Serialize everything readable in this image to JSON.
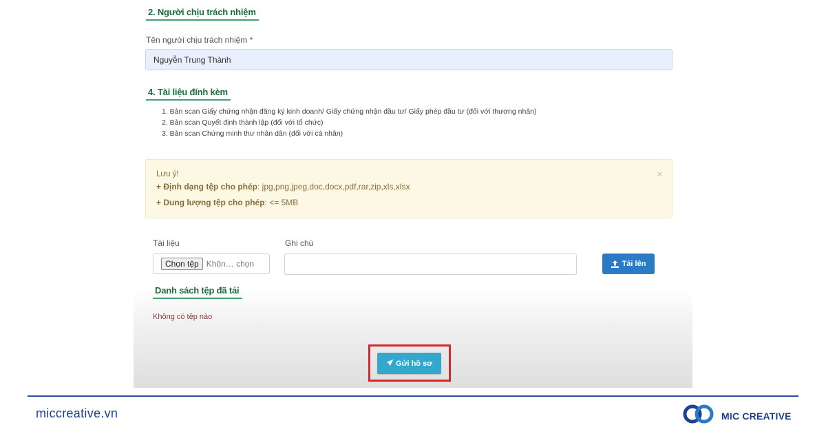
{
  "section2": {
    "title": "2. Người chịu trách nhiệm",
    "name_label": "Tên người chịu trách nhiệm",
    "required_mark": "*",
    "name_value": "Nguyễn Trung Thành"
  },
  "section4": {
    "title": "4. Tài liệu đính kèm",
    "items": [
      "1. Bản scan Giấy chứng nhận đăng ký kinh doanh/ Giấy chứng nhận đầu tư/ Giấy phép đầu tư (đối với thương nhân)",
      "2. Bản scan Quyết định thành lập (đối với tổ chức)",
      "3. Bản scan Chứng minh thư nhân dân (đối với cá nhân)"
    ]
  },
  "alert": {
    "title": "Lưu ý!",
    "format_label": "+ Định dạng tệp cho phép",
    "format_value": ": jpg,png,jpeg,doc,docx,pdf,rar,zip,xls,xlsx",
    "size_label": "+ Dung lượng tệp cho phép",
    "size_value": ": <= 5MB",
    "close_symbol": "×"
  },
  "upload": {
    "doc_label": "Tài liệu",
    "note_label": "Ghi chú",
    "choose_button": "Chọn tệp",
    "file_status": "Khôn… chọn",
    "note_value": "",
    "upload_button": "Tải lên"
  },
  "uploaded": {
    "title": "Danh sách tệp đã tải",
    "empty_message": "Không có tệp nào"
  },
  "submit": {
    "label": "Gửi hồ sơ"
  },
  "footer": {
    "site": "miccreative.vn",
    "brand": "MIC CREATIVE"
  },
  "colors": {
    "section_title": "#1e6b3e",
    "upload_button": "#2a7ac6",
    "submit_button": "#34a7cc",
    "highlight_border": "#d4262b",
    "brand": "#1d3f91"
  },
  "icons": {
    "upload": "upload-icon",
    "submit": "paper-plane-icon",
    "close": "close-icon",
    "logo": "infinity-logo-icon"
  }
}
